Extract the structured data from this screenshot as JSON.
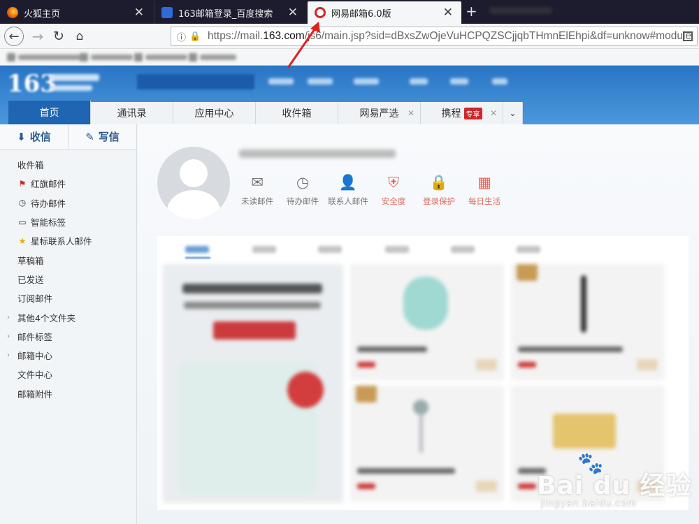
{
  "browser": {
    "tabs": [
      {
        "label": "火狐主页",
        "icon": "firefox-icon",
        "color": "#e66000"
      },
      {
        "label": "163邮箱登录_百度搜索",
        "icon": "baidu-paw-icon",
        "color": "#2f6bd8"
      },
      {
        "label": "网易邮箱6.0版",
        "icon": "netease-mail-icon",
        "color": "#d0262a"
      }
    ],
    "url_prefix": "https://mail.",
    "url_domain": "163.com",
    "url_suffix": "/js6/main.jsp?sid=dBxsZwOjeVuHCPQZSCjjqbTHmnElEhpi&df=unknow#module"
  },
  "mail": {
    "tabs": [
      {
        "label": "首页"
      },
      {
        "label": "通讯录"
      },
      {
        "label": "应用中心"
      },
      {
        "label": "收件箱"
      },
      {
        "label": "网易严选"
      },
      {
        "label": "携程",
        "badge": "专享"
      }
    ],
    "compose": {
      "receive": "收信",
      "write": "写信"
    },
    "folders": [
      {
        "label": "收件箱",
        "icon": ""
      },
      {
        "label": "红旗邮件",
        "icon": "red-flag-icon"
      },
      {
        "label": "待办邮件",
        "icon": "clock-icon"
      },
      {
        "label": "智能标签",
        "icon": "tag-icon"
      },
      {
        "label": "星标联系人邮件",
        "icon": "star-icon"
      },
      {
        "label": "草稿箱",
        "icon": ""
      },
      {
        "label": "已发送",
        "icon": ""
      },
      {
        "label": "订阅邮件",
        "icon": ""
      },
      {
        "label": "其他4个文件夹",
        "icon": "",
        "expandable": true
      },
      {
        "label": "邮件标签",
        "icon": "",
        "expandable": true
      },
      {
        "label": "邮箱中心",
        "icon": "",
        "expandable": true
      },
      {
        "label": "文件中心",
        "icon": ""
      },
      {
        "label": "邮箱附件",
        "icon": ""
      }
    ],
    "quick_links": [
      {
        "label": "未读邮件",
        "icon": "envelope-icon"
      },
      {
        "label": "待办邮件",
        "icon": "clock-icon"
      },
      {
        "label": "联系人邮件",
        "icon": "contact-star-icon"
      },
      {
        "label": "安全度",
        "icon": "shield-icon"
      },
      {
        "label": "登录保护",
        "icon": "lock-icon"
      },
      {
        "label": "每日生活",
        "icon": "calendar-icon"
      }
    ],
    "accent_color": "#1f65b1"
  },
  "watermark": {
    "brand": "Bai du 经验",
    "site": "jingyan.baidu.com"
  }
}
